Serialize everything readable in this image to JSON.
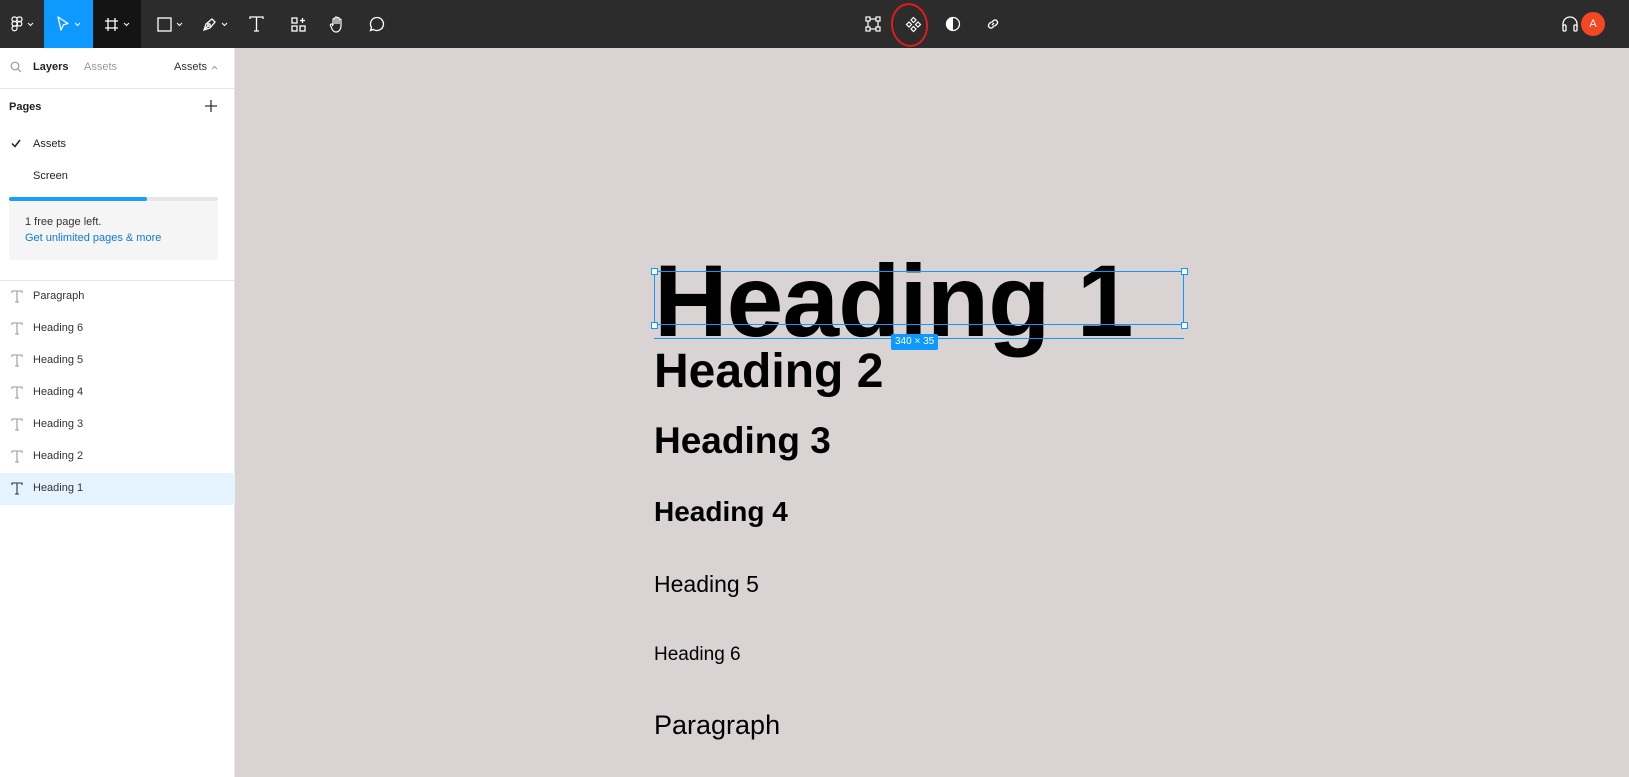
{
  "toolbar": {
    "main_menu_icon": "figma-logo-icon",
    "tools": [
      "move-tool",
      "frame-tool",
      "shape-tool",
      "pen-tool",
      "text-tool",
      "resources-tool",
      "hand-tool",
      "comment-tool"
    ],
    "center_actions": [
      "edit-object-icon",
      "component-icon",
      "mask-icon",
      "link-icon"
    ],
    "user_initial": "A",
    "colors": {
      "bg": "#2c2c2c",
      "active": "#0d99ff",
      "avatar": "#f24822",
      "annotation": "#e01b1b"
    }
  },
  "left_panel": {
    "tabs": {
      "layers": "Layers",
      "assets": "Assets"
    },
    "pages_dropdown": "Assets",
    "pages_title": "Pages",
    "pages": [
      {
        "name": "Assets",
        "current": true
      },
      {
        "name": "Screen",
        "current": false
      }
    ],
    "upsell": {
      "message": "1 free page left.",
      "link": "Get unlimited pages & more",
      "progress": 0.66
    },
    "layers": [
      "Paragraph",
      "Heading 6",
      "Heading 5",
      "Heading 4",
      "Heading 3",
      "Heading 2",
      "Heading 1"
    ],
    "selected_layer": "Heading 1"
  },
  "canvas": {
    "texts": {
      "h1": "Heading 1",
      "h2": "Heading 2",
      "h3": "Heading 3",
      "h4": "Heading 4",
      "h5": "Heading 5",
      "h6": "Heading 6",
      "paragraph": "Paragraph"
    },
    "selection_dimensions": "340 × 35",
    "colors": {
      "bg": "#d9d3d4",
      "selection": "#0d99ff"
    }
  }
}
